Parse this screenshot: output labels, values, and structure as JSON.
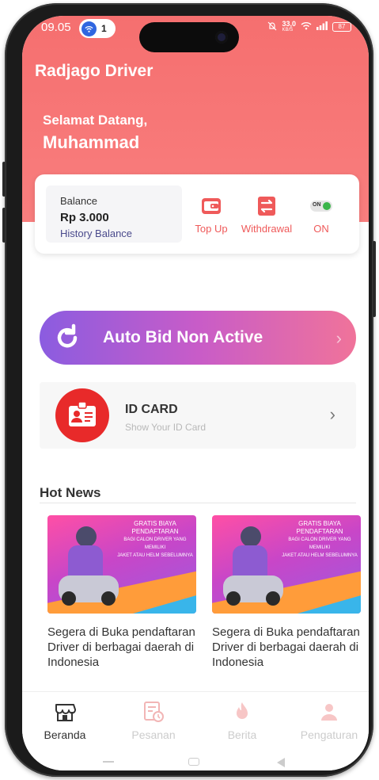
{
  "status_bar": {
    "time": "09.05",
    "notification_count": "1",
    "network_speed": "33,0",
    "network_unit": "KB/S",
    "battery": "87"
  },
  "app": {
    "title": "Radjago Driver"
  },
  "greeting": {
    "welcome": "Selamat Datang,",
    "name": "Muhammad"
  },
  "wallet": {
    "balance_label": "Balance",
    "balance_value": "Rp 3.000",
    "history_label": "History Balance",
    "topup_label": "Top Up",
    "withdrawal_label": "Withdrawal",
    "toggle_badge": "ON",
    "status_label": "ON",
    "accent_color": "#ef5a5a"
  },
  "autobid": {
    "label": "Auto Bid Non Active"
  },
  "idcard": {
    "title": "ID CARD",
    "subtitle": "Show Your ID Card"
  },
  "hot_news": {
    "title": "Hot News",
    "items": [
      {
        "title": "Segera di Buka pendaftaran Driver di berbagai daerah di Indonesia",
        "banner_line1": "GRATIS BIAYA PENDAFTARAN",
        "banner_line2": "BAGI CALON DRIVER YANG MEMILIKI",
        "banner_line3": "JAKET ATAU HELM SEBELUMNYA"
      },
      {
        "title": "Segera di Buka pendaftaran Driver di berbagai daerah di Indonesia",
        "banner_line1": "GRATIS BIAYA PENDAFTARAN",
        "banner_line2": "BAGI CALON DRIVER YANG MEMILIKI",
        "banner_line3": "JAKET ATAU HELM SEBELUMNYA"
      }
    ]
  },
  "bottom_nav": [
    {
      "label": "Beranda",
      "icon": "store-icon",
      "active": true
    },
    {
      "label": "Pesanan",
      "icon": "order-history-icon",
      "active": false
    },
    {
      "label": "Berita",
      "icon": "flame-icon",
      "active": false
    },
    {
      "label": "Pengaturan",
      "icon": "user-icon",
      "active": false
    }
  ],
  "colors": {
    "header": "#f56f6f",
    "accent": "#ef5a5a",
    "idcard_icon_bg": "#e82a2a"
  }
}
